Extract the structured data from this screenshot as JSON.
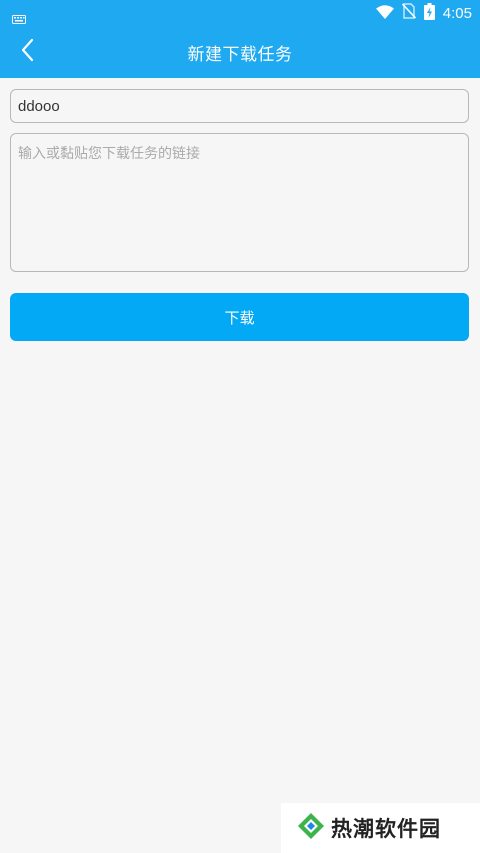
{
  "status_bar": {
    "time": "4:05",
    "icons": [
      "keyboard-icon",
      "wifi-icon",
      "no-sim-icon",
      "battery-charging-icon"
    ]
  },
  "app_bar": {
    "title": "新建下载任务",
    "back_icon": "chevron-left-icon"
  },
  "form": {
    "name_value": "ddooo",
    "link_placeholder": "输入或黏贴您下载任务的链接",
    "download_label": "下载"
  },
  "watermark": {
    "text": "热潮软件园"
  },
  "colors": {
    "primary": "#1fa9f1",
    "button": "#03a9f4",
    "background": "#f6f6f6"
  }
}
